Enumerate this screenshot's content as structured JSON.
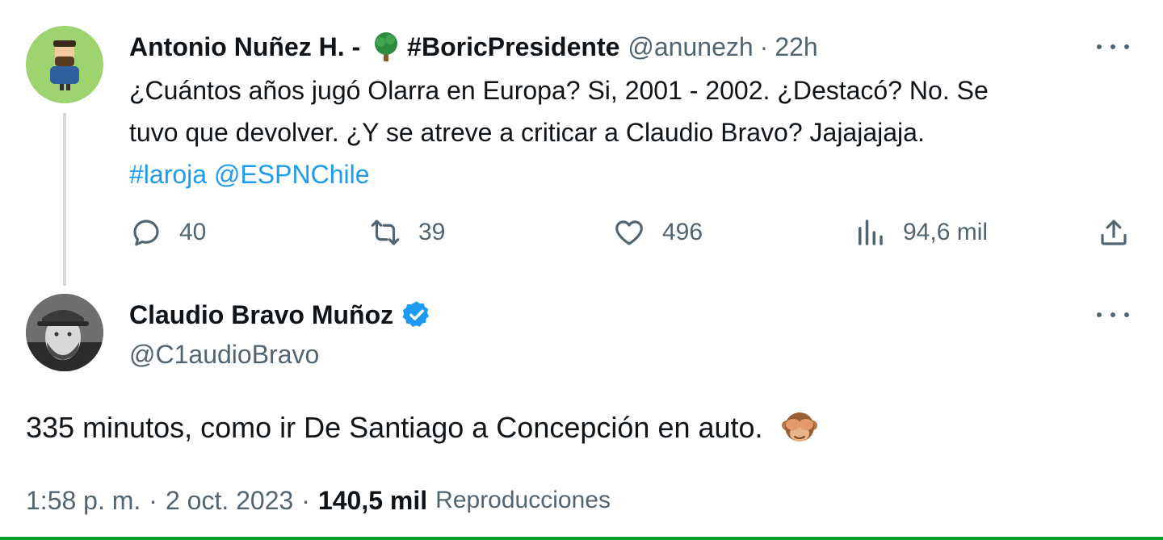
{
  "tweet1": {
    "author_name": "Antonio Nuñez H. -",
    "author_hashtag": "#BoricPresidente",
    "handle": "@anunezh",
    "separator": "·",
    "time": "22h",
    "text_line1": "¿Cuántos años jugó Olarra en Europa? Si, 2001 - 2002. ¿Destacó? No. Se",
    "text_line2": "tuvo que devolver. ¿Y se atreve a criticar a Claudio Bravo?  Jajajajaja.",
    "hashtag_link": "#laroja",
    "mention_link": "@ESPNChile",
    "replies": "40",
    "retweets": "39",
    "likes": "496",
    "views": "94,6 mil"
  },
  "tweet2": {
    "author_name": "Claudio Bravo Muñoz",
    "handle": "@C1audioBravo",
    "text": "335 minutos, como ir De Santiago a Concepción en auto.",
    "time": "1:58 p. m.",
    "separator": "·",
    "date": "2 oct. 2023",
    "views_count": "140,5 mil",
    "views_label": "Reproducciones"
  },
  "colors": {
    "text": "#0f1419",
    "secondary": "#536471",
    "link": "#1d9bf0",
    "verified": "#1d9bf0",
    "thread_line": "#cfd9de"
  },
  "icons": [
    "tree-emoji-icon",
    "more-icon",
    "reply-icon",
    "retweet-icon",
    "like-icon",
    "views-icon",
    "share-icon",
    "verified-icon",
    "see-no-evil-monkey-icon"
  ]
}
